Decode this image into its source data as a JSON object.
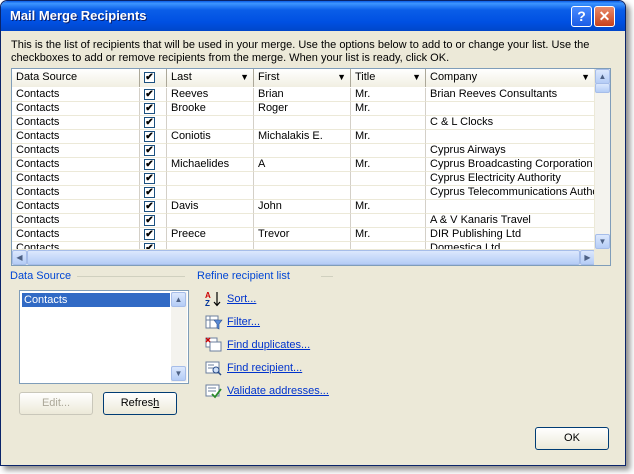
{
  "window": {
    "title": "Mail Merge Recipients",
    "help_glyph": "?",
    "close_glyph": "✕"
  },
  "intro_text": "This is the list of recipients that will be used in your merge.  Use the options below to add to or change your list.  Use the checkboxes to add or remove recipients from the merge.  When your list is ready, click OK.",
  "grid": {
    "columns": {
      "source": "Data Source",
      "last": "Last",
      "first": "First",
      "title": "Title",
      "company": "Company"
    },
    "header_checked": true,
    "rows": [
      {
        "source": "Contacts",
        "checked": true,
        "last": "Reeves",
        "first": "Brian",
        "title": "Mr.",
        "company": "Brian Reeves Consultants"
      },
      {
        "source": "Contacts",
        "checked": true,
        "last": "Brooke",
        "first": "Roger",
        "title": "Mr.",
        "company": ""
      },
      {
        "source": "Contacts",
        "checked": true,
        "last": "",
        "first": "",
        "title": "",
        "company": "C & L Clocks"
      },
      {
        "source": "Contacts",
        "checked": true,
        "last": "Coniotis",
        "first": "Michalakis E.",
        "title": "Mr.",
        "company": ""
      },
      {
        "source": "Contacts",
        "checked": true,
        "last": "",
        "first": "",
        "title": "",
        "company": "Cyprus Airways"
      },
      {
        "source": "Contacts",
        "checked": true,
        "last": "Michaelides",
        "first": "A",
        "title": "Mr.",
        "company": "Cyprus Broadcasting Corporation"
      },
      {
        "source": "Contacts",
        "checked": true,
        "last": "",
        "first": "",
        "title": "",
        "company": "Cyprus Electricity Authority"
      },
      {
        "source": "Contacts",
        "checked": true,
        "last": "",
        "first": "",
        "title": "",
        "company": "Cyprus Telecommunications Autho..."
      },
      {
        "source": "Contacts",
        "checked": true,
        "last": "Davis",
        "first": "John",
        "title": "Mr.",
        "company": ""
      },
      {
        "source": "Contacts",
        "checked": true,
        "last": "",
        "first": "",
        "title": "",
        "company": "A & V Kanaris Travel"
      },
      {
        "source": "Contacts",
        "checked": true,
        "last": "Preece",
        "first": "Trevor",
        "title": "Mr.",
        "company": "DIR Publishing Ltd"
      },
      {
        "source": "Contacts",
        "checked": true,
        "last": "",
        "first": "",
        "title": "",
        "company": "Domestica Ltd"
      }
    ]
  },
  "data_source": {
    "label": "Data Source",
    "items": [
      "Contacts"
    ],
    "edit_label": "Edit...",
    "refresh_label": "Refresh"
  },
  "refine": {
    "label": "Refine recipient list",
    "actions": [
      {
        "label": "Sort...",
        "icon": "sort-az-icon"
      },
      {
        "label": "Filter...",
        "icon": "filter-icon"
      },
      {
        "label": "Find duplicates...",
        "icon": "find-duplicates-icon"
      },
      {
        "label": "Find recipient...",
        "icon": "find-recipient-icon"
      },
      {
        "label": "Validate addresses...",
        "icon": "validate-addresses-icon"
      }
    ]
  },
  "ok_label": "OK",
  "colors": {
    "titlebar": "#0a5ee8",
    "dialog_bg": "#ece9d8",
    "link": "#0033cc",
    "group_label": "#0046d5",
    "selection": "#316ac5"
  }
}
